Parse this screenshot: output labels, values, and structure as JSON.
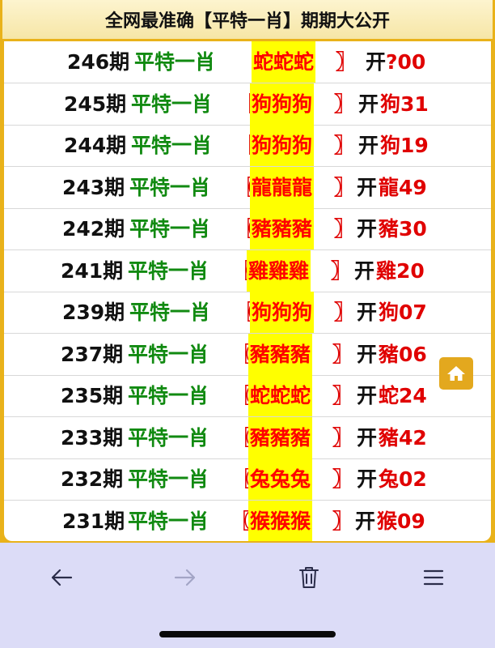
{
  "header": {
    "title": "全网最准确【平特一肖】期期大公开"
  },
  "rows": [
    {
      "period": "246期",
      "label": "平特一肖",
      "bl": "〖",
      "zodiac": "蛇蛇蛇",
      "br": "〗",
      "open": "开",
      "result": "?00"
    },
    {
      "period": "245期",
      "label": "平特一肖",
      "bl": "〖",
      "zodiac": "狗狗狗",
      "br": "〗",
      "open": "开",
      "result": "狗31"
    },
    {
      "period": "244期",
      "label": "平特一肖",
      "bl": "〖",
      "zodiac": "狗狗狗",
      "br": "〗",
      "open": "开",
      "result": "狗19"
    },
    {
      "period": "243期",
      "label": "平特一肖",
      "bl": "〖",
      "zodiac": "龍龍龍",
      "br": "〗",
      "open": "开",
      "result": "龍49"
    },
    {
      "period": "242期",
      "label": "平特一肖",
      "bl": "〖",
      "zodiac": "豬豬豬",
      "br": "〗",
      "open": "开",
      "result": "豬30"
    },
    {
      "period": "241期",
      "label": "平特一肖",
      "bl": "〖",
      "zodiac": "雞雞雞",
      "br": "〗",
      "open": "开",
      "result": "雞20"
    },
    {
      "period": "239期",
      "label": "平特一肖",
      "bl": "〖",
      "zodiac": "狗狗狗",
      "br": "〗",
      "open": "开",
      "result": "狗07"
    },
    {
      "period": "237期",
      "label": "平特一肖",
      "bl": "〖",
      "zodiac": "豬豬豬",
      "br": "〗",
      "open": "开",
      "result": "豬06"
    },
    {
      "period": "235期",
      "label": "平特一肖",
      "bl": "〖",
      "zodiac": "蛇蛇蛇",
      "br": "〗",
      "open": "开",
      "result": "蛇24"
    },
    {
      "period": "233期",
      "label": "平特一肖",
      "bl": "〖",
      "zodiac": "豬豬豬",
      "br": "〗",
      "open": "开",
      "result": "豬42"
    },
    {
      "period": "232期",
      "label": "平特一肖",
      "bl": "〖",
      "zodiac": "兔兔兔",
      "br": "〗",
      "open": "开",
      "result": "兔02"
    },
    {
      "period": "231期",
      "label": "平特一肖",
      "bl": "〖",
      "zodiac": "猴猴猴",
      "br": "〗",
      "open": "开",
      "result": "猴09"
    }
  ],
  "colors": {
    "frame": "#e9b21a",
    "header_bg": "#f8eab0",
    "period_text": "#111111",
    "label_green": "#118a11",
    "highlight_bg": "#ffff00",
    "highlight_text": "#ff0000",
    "result_red": "#e00000",
    "home_button": "#e3a81e",
    "toolbar_bg": "#dcdcf7"
  },
  "icons": {
    "home": "home-icon",
    "back": "arrow-left-icon",
    "forward": "arrow-right-icon",
    "trash": "trash-icon",
    "menu": "hamburger-menu-icon"
  }
}
